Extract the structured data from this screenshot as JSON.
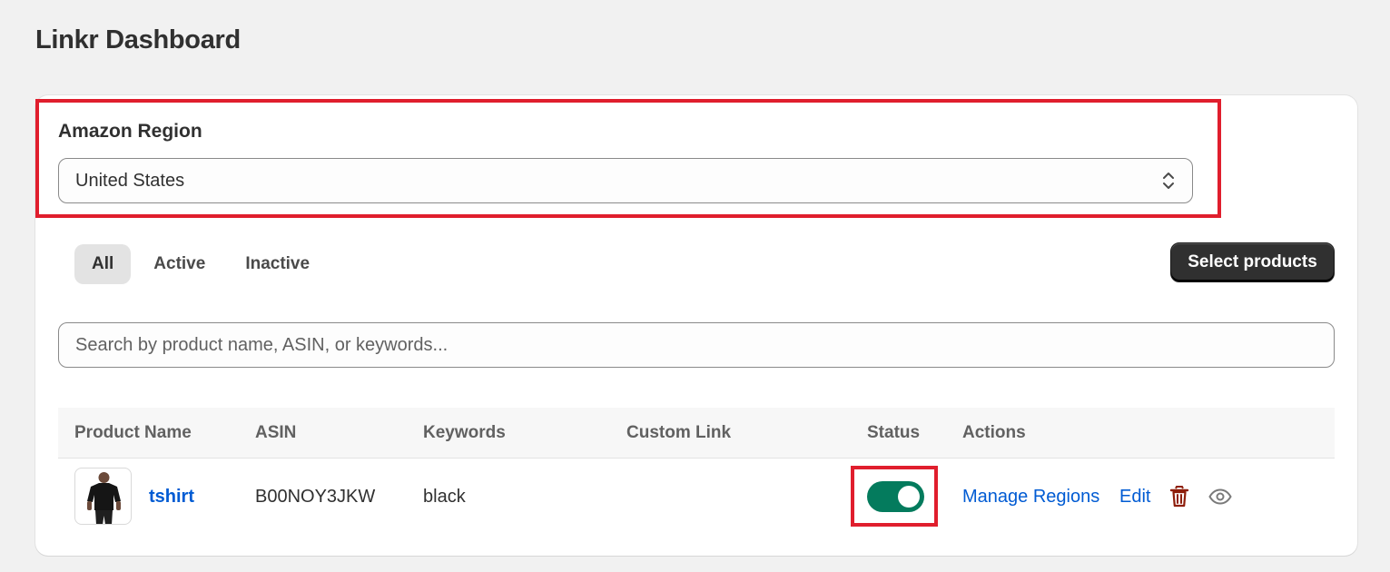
{
  "page": {
    "title": "Linkr Dashboard"
  },
  "region": {
    "label": "Amazon Region",
    "selected": "United States"
  },
  "tabs": [
    {
      "label": "All",
      "active": true
    },
    {
      "label": "Active",
      "active": false
    },
    {
      "label": "Inactive",
      "active": false
    }
  ],
  "toolbar": {
    "select_products_label": "Select products"
  },
  "search": {
    "placeholder": "Search by product name, ASIN, or keywords...",
    "value": ""
  },
  "table": {
    "headers": [
      "Product Name",
      "ASIN",
      "Keywords",
      "Custom Link",
      "Status",
      "Actions"
    ],
    "rows": [
      {
        "product_name": "tshirt",
        "asin": "B00NOY3JKW",
        "keywords": "black",
        "custom_link": "",
        "status_on": true,
        "actions": {
          "manage_regions": "Manage Regions",
          "edit": "Edit"
        }
      }
    ]
  },
  "icons": {
    "select_chevron": "chevron-up-down-icon",
    "delete": "trash-icon",
    "preview": "eye-icon",
    "thumbnail": "product-thumbnail"
  },
  "colors": {
    "primary_button": "#303030",
    "link": "#005bd3",
    "toggle_on": "#047b5d",
    "delete_icon": "#8e1f0b",
    "highlight": "#e01e2d"
  }
}
